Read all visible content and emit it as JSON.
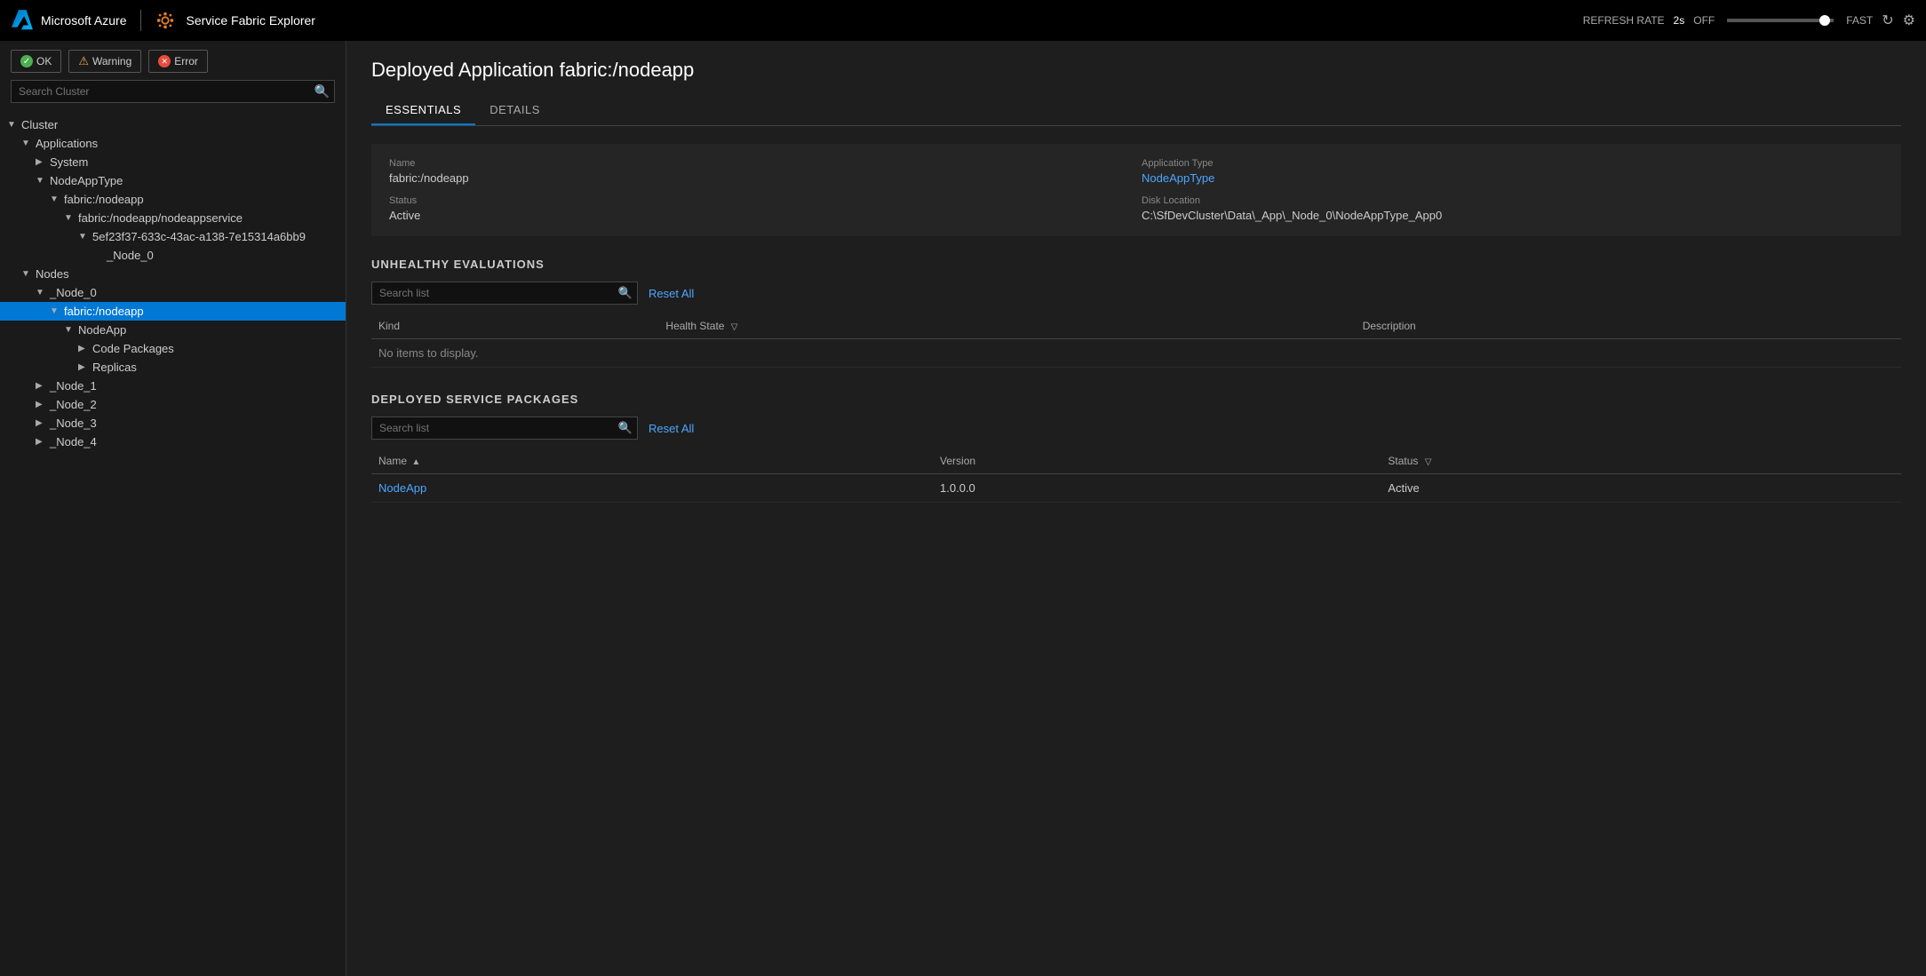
{
  "topbar": {
    "brand": "Microsoft Azure",
    "app_name": "Service Fabric Explorer",
    "refresh_label": "REFRESH RATE",
    "refresh_rate": "2s",
    "refresh_off": "OFF",
    "refresh_fast": "FAST"
  },
  "filters": [
    {
      "id": "ok",
      "label": "OK",
      "icon": "✓",
      "type": "ok"
    },
    {
      "id": "warning",
      "label": "Warning",
      "icon": "⚠",
      "type": "warning"
    },
    {
      "id": "error",
      "label": "Error",
      "icon": "✕",
      "type": "error"
    }
  ],
  "search_cluster": {
    "placeholder": "Search Cluster"
  },
  "tree": [
    {
      "indent": "indent-0",
      "chevron": "▼",
      "label": "Cluster",
      "selected": false
    },
    {
      "indent": "indent-1",
      "chevron": "▼",
      "label": "Applications",
      "selected": false
    },
    {
      "indent": "indent-2",
      "chevron": "▶",
      "label": "System",
      "selected": false
    },
    {
      "indent": "indent-2",
      "chevron": "▼",
      "label": "NodeAppType",
      "selected": false
    },
    {
      "indent": "indent-3",
      "chevron": "▼",
      "label": "fabric:/nodeapp",
      "selected": false
    },
    {
      "indent": "indent-4",
      "chevron": "▼",
      "label": "fabric:/nodeapp/nodeappservice",
      "selected": false
    },
    {
      "indent": "indent-5",
      "chevron": "▼",
      "label": "5ef23f37-633c-43ac-a138-7e15314a6bb9",
      "selected": false
    },
    {
      "indent": "indent-6",
      "chevron": "",
      "label": "_Node_0",
      "selected": false
    },
    {
      "indent": "indent-1",
      "chevron": "▼",
      "label": "Nodes",
      "selected": false
    },
    {
      "indent": "indent-2",
      "chevron": "▼",
      "label": "_Node_0",
      "selected": false
    },
    {
      "indent": "indent-3",
      "chevron": "▼",
      "label": "fabric:/nodeapp",
      "selected": true
    },
    {
      "indent": "indent-4",
      "chevron": "▼",
      "label": "NodeApp",
      "selected": false
    },
    {
      "indent": "indent-5",
      "chevron": "▶",
      "label": "Code Packages",
      "selected": false
    },
    {
      "indent": "indent-5",
      "chevron": "▶",
      "label": "Replicas",
      "selected": false
    },
    {
      "indent": "indent-2",
      "chevron": "▶",
      "label": "_Node_1",
      "selected": false
    },
    {
      "indent": "indent-2",
      "chevron": "▶",
      "label": "_Node_2",
      "selected": false
    },
    {
      "indent": "indent-2",
      "chevron": "▶",
      "label": "_Node_3",
      "selected": false
    },
    {
      "indent": "indent-2",
      "chevron": "▶",
      "label": "_Node_4",
      "selected": false
    }
  ],
  "main": {
    "title_prefix": "Deployed Application",
    "title_name": "fabric:/nodeapp",
    "tabs": [
      {
        "id": "essentials",
        "label": "ESSENTIALS",
        "active": true
      },
      {
        "id": "details",
        "label": "DETAILS",
        "active": false
      }
    ],
    "essentials": {
      "name_label": "Name",
      "name_value": "fabric:/nodeapp",
      "app_type_label": "Application Type",
      "app_type_value": "NodeAppType",
      "status_label": "Status",
      "status_value": "Active",
      "disk_location_label": "Disk Location",
      "disk_location_value": "C:\\SfDevCluster\\Data\\_App\\_Node_0\\NodeAppType_App0"
    },
    "unhealthy": {
      "section_title": "UNHEALTHY EVALUATIONS",
      "search_placeholder": "Search list",
      "reset_all": "Reset All",
      "columns": [
        {
          "label": "Kind",
          "filter": false,
          "sort": false
        },
        {
          "label": "Health State",
          "filter": true,
          "sort": false
        },
        {
          "label": "Description",
          "filter": false,
          "sort": false
        }
      ],
      "no_items": "No items to display.",
      "rows": []
    },
    "deployed_packages": {
      "section_title": "DEPLOYED SERVICE PACKAGES",
      "search_placeholder": "Search list",
      "reset_all": "Reset All",
      "columns": [
        {
          "label": "Name",
          "filter": false,
          "sort": true
        },
        {
          "label": "Version",
          "filter": false,
          "sort": false
        },
        {
          "label": "Status",
          "filter": true,
          "sort": false
        }
      ],
      "rows": [
        {
          "name": "NodeApp",
          "version": "1.0.0.0",
          "status": "Active"
        }
      ]
    }
  }
}
